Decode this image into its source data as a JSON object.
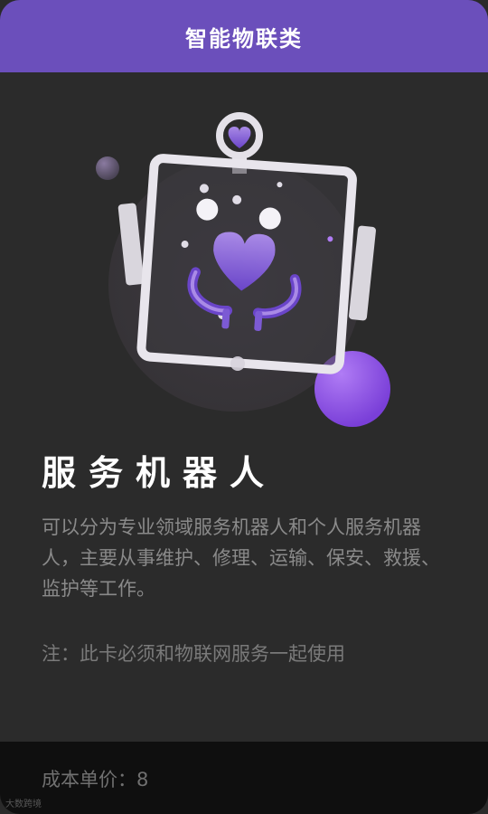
{
  "header": {
    "title": "智能物联类"
  },
  "card": {
    "name": "服务机器人",
    "description": "可以分为专业领域服务机器人和个人服务机器人，主要从事维护、修理、运输、保安、救援、监护等工作。",
    "note": "注：此卡必须和物联网服务一起使用"
  },
  "footer": {
    "cost_label": "成本单价：",
    "cost_value": "8",
    "watermark": "大数跨境"
  },
  "illustration": {
    "icon": "service-robot-heart-icon"
  },
  "colors": {
    "header": "#6b4fbb",
    "background": "#2b2b2b",
    "footer": "#0f0f0f",
    "accent": "#8b5cf6"
  }
}
